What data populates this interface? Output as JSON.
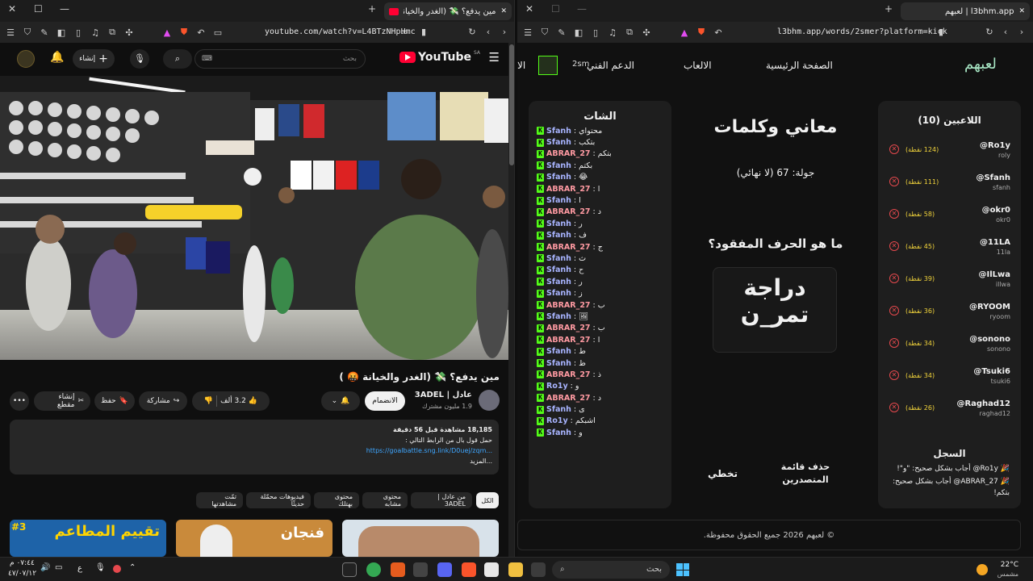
{
  "left": {
    "tab_title": "مين يدفع؟ 💸 (الغدر والخيانة🤬)",
    "url": "youtube.com/watch?v=L4BTzNHpHmc",
    "yt": {
      "logo": "YouTube",
      "region": "SA",
      "search_placeholder": "بحث",
      "create_label": "إنشاء"
    },
    "video": {
      "title": "مين يدفع؟ 💸 (الغدر والخيانة 🤬 )",
      "channel": "عادل | 3ADEL",
      "subs": "1.9 مليون مشترك",
      "join": "الانضمام",
      "likes": "3.2 ألف",
      "share": "مشاركة",
      "save": "حفظ",
      "clip": "إنشاء مقطع",
      "views": "18,185 مشاهدة قبل 56 دقيقة",
      "desc1": "حمل قول بال من الرابط التالي :",
      "desc_link": "https://goalbattle.sng.link/D0uej/zqm...",
      "more": "...المزيد"
    },
    "chips": [
      "الكل",
      "من عادل | 3ADEL",
      "محتوى مشابه",
      "محتوى بهتلك",
      "فيديوهات محمّلة حديثًا",
      "تمّت مشاهدتها"
    ],
    "thumbs": [
      "تقييم المطاعم",
      "فنجان",
      ""
    ],
    "thumb_badge": "#3"
  },
  "right": {
    "tab_title": "l3bhm.app | لعبهم",
    "url": "l3bhm.app/words/2smer?platform=kick",
    "nav": {
      "logo": "لعبهم",
      "home": "الصفحة الرئيسية",
      "games": "الالعاب",
      "support": "الدعم الفني",
      "user": "2sm",
      "other": "الا"
    },
    "players": {
      "title": "اللاعبين (10)",
      "list": [
        {
          "name": "@Ro1y",
          "sub": "roly",
          "pts": "(124 نقطة)"
        },
        {
          "name": "@Sfanh",
          "sub": "sfanh",
          "pts": "(111 نقطة)"
        },
        {
          "name": "@okr0",
          "sub": "okr0",
          "pts": "(58 نقطة)"
        },
        {
          "name": "@11LA",
          "sub": "11la",
          "pts": "(45 نقطة)"
        },
        {
          "name": "@IlLwa",
          "sub": "illwa",
          "pts": "(39 نقطة)"
        },
        {
          "name": "@RYOOM",
          "sub": "ryoom",
          "pts": "(36 نقطة)"
        },
        {
          "name": "@sonono",
          "sub": "sonono",
          "pts": "(34 نقطة)"
        },
        {
          "name": "@Tsuki6",
          "sub": "tsuki6",
          "pts": "(34 نقطة)"
        },
        {
          "name": "@Raghad12",
          "sub": "raghad12",
          "pts": "(26 نقطة)"
        }
      ]
    },
    "game": {
      "title": "معاني وكلمات",
      "round": "جولة: 67 (لا نهائي)",
      "question": "ما هو الحرف المفقود؟",
      "word1": "دراجة",
      "word2": "تمر_ن",
      "skip": "تخطي",
      "delete": "حذف قائمة المتصدرين"
    },
    "log": {
      "title": "السجل",
      "line1": "🎉 Ro1y@ أجاب بشكل صحيح: \"و\"!",
      "line2": "🎉 ABRAR_27@ أجاب بشكل صحيح: بتكم!"
    },
    "chat": {
      "title": "الشات",
      "lines": [
        {
          "u": "Sfanh",
          "m": "محتواي"
        },
        {
          "u": "Sfanh",
          "m": "بتكب"
        },
        {
          "u": "ABRAR_27",
          "m": "بتكم"
        },
        {
          "u": "Sfanh",
          "m": "بكتم"
        },
        {
          "u": "Sfanh",
          "m": "😂"
        },
        {
          "u": "ABRAR_27",
          "m": "ا"
        },
        {
          "u": "Sfanh",
          "m": "ا"
        },
        {
          "u": "ABRAR_27",
          "m": "د"
        },
        {
          "u": "Sfanh",
          "m": "ر"
        },
        {
          "u": "Sfanh",
          "m": "ف"
        },
        {
          "u": "ABRAR_27",
          "m": "ج"
        },
        {
          "u": "Sfanh",
          "m": "ث"
        },
        {
          "u": "Sfanh",
          "m": "ح"
        },
        {
          "u": "Sfanh",
          "m": "ر"
        },
        {
          "u": "Sfanh",
          "m": "ز"
        },
        {
          "u": "ABRAR_27",
          "m": "ب"
        },
        {
          "u": "Sfanh",
          "m": "🖼"
        },
        {
          "u": "ABRAR_27",
          "m": "ب"
        },
        {
          "u": "ABRAR_27",
          "m": "ا"
        },
        {
          "u": "Sfanh",
          "m": "ط"
        },
        {
          "u": "Sfanh",
          "m": "ظ"
        },
        {
          "u": "ABRAR_27",
          "m": "ذ"
        },
        {
          "u": "Ro1y",
          "m": "و"
        },
        {
          "u": "ABRAR_27",
          "m": "د"
        },
        {
          "u": "Sfanh",
          "m": "ى"
        },
        {
          "u": "Ro1y",
          "m": "اشبكم"
        },
        {
          "u": "Sfanh",
          "m": "و"
        }
      ]
    },
    "footer": "© لعبهم 2026 جميع الحقوق محفوظة."
  },
  "taskbar": {
    "weather_temp": "22°C",
    "weather_text": "مشمس",
    "search": "بحث",
    "time": "٠٧:٤٤ م",
    "date": "٤٧/٠٧/١٢",
    "lang": "ع"
  },
  "colors": {
    "accent_green": "#53fc18",
    "yt_red": "#ff0033",
    "points": "#f2d43b"
  }
}
